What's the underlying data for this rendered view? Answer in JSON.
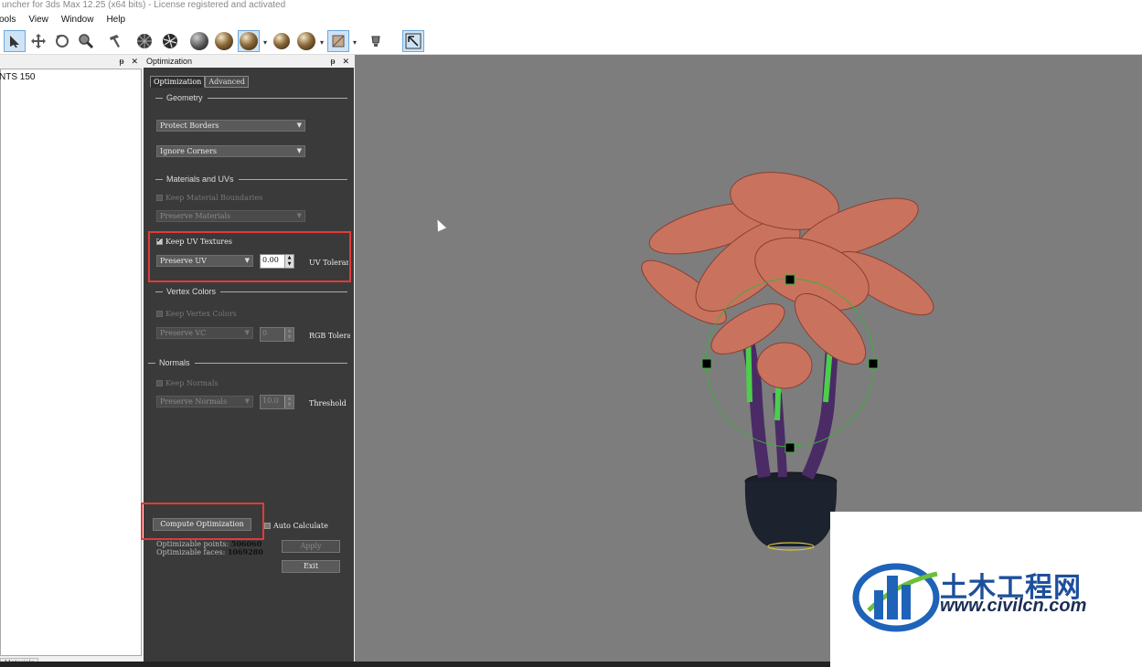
{
  "window": {
    "title": "uncher for 3ds Max 12.25 (x64 bits) - License registered and activated"
  },
  "menu": [
    "Tools",
    "View",
    "Window",
    "Help"
  ],
  "left_panel": {
    "pin": "ᵽ",
    "close": "✕",
    "item": "NTS 150",
    "tab": "Materials"
  },
  "panel": {
    "title": "Optimization",
    "pin": "ᵽ",
    "close": "✕",
    "tabs": [
      "Optimization",
      "Advanced"
    ],
    "geometry": {
      "label": "Geometry",
      "protect_borders": "Protect Borders",
      "ignore_corners": "Ignore Corners"
    },
    "materials": {
      "label": "Materials and UVs",
      "keep_boundaries": "Keep Material Boundaries",
      "preserve_materials": "Preserve Materials"
    },
    "uv": {
      "keep_uv": "Keep UV Textures",
      "preserve_uv": "Preserve UV",
      "tolerance_value": "0.00",
      "tolerance_label": "UV Tolerance"
    },
    "vertex_colors": {
      "label": "Vertex Colors",
      "keep_vc": "Keep Vertex Colors",
      "preserve_vc": "Preserve VC",
      "tolerance_value": "0",
      "tolerance_label": "RGB Tolerance"
    },
    "normals": {
      "label": "Normals",
      "keep_normals": "Keep Normals",
      "preserve_normals": "Preserve Normals",
      "threshold_value": "10.0",
      "threshold_label": "Threshold"
    },
    "compute_button": "Compute Optimization",
    "auto_calculate": "Auto Calculate",
    "optimizable_points_label": "Optimizable points:",
    "optimizable_points": "506060",
    "optimizable_faces_label": "Optimizable faces:",
    "optimizable_faces": "1069280",
    "apply_button": "Apply",
    "exit_button": "Exit"
  },
  "colors": {
    "highlight": "#e23a3a",
    "panel_bg": "#3a3a3a",
    "viewport_bg": "#7d7d7d",
    "gizmo": "#3fae3f"
  },
  "watermark": {
    "brand": "土木工程网",
    "url": "www.civilcn.com"
  }
}
